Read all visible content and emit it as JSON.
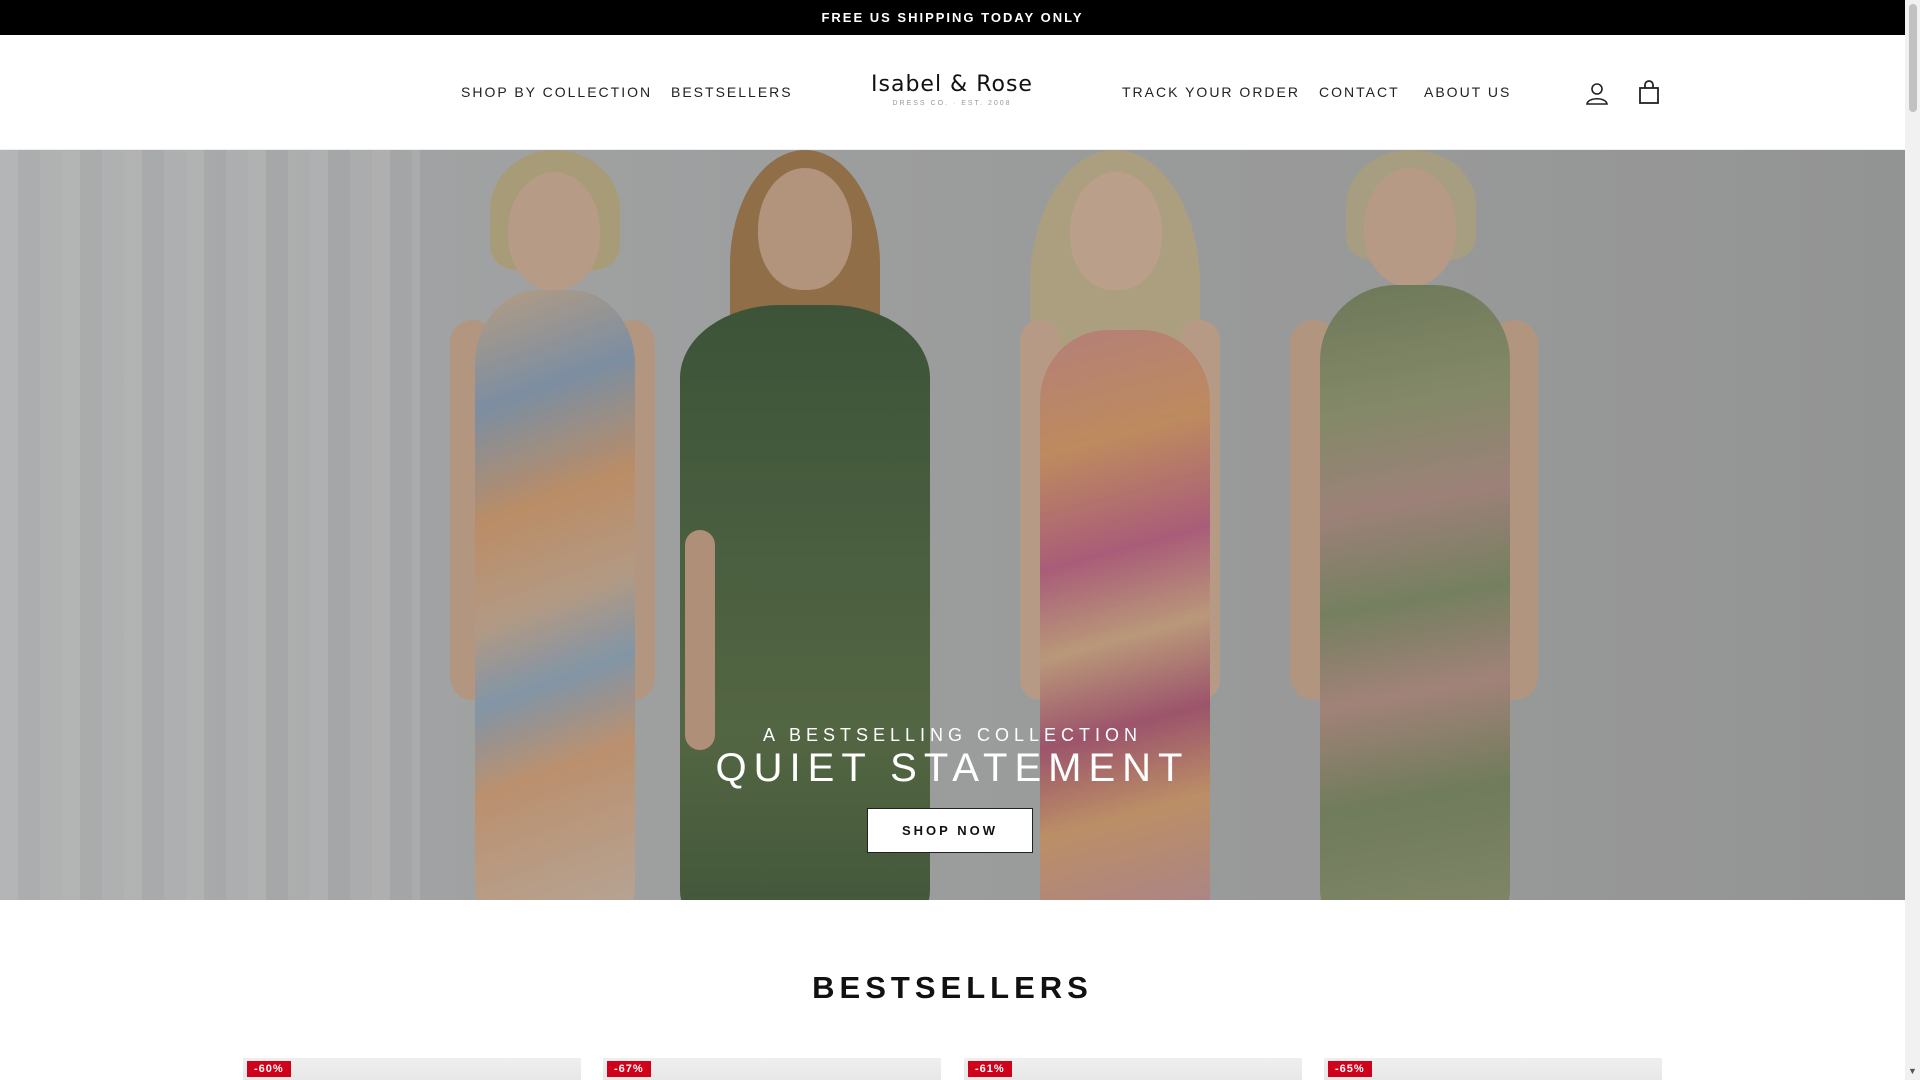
{
  "announcement": {
    "text": "FREE US SHIPPING TODAY ONLY"
  },
  "header": {
    "nav_left": [
      "SHOP BY COLLECTION",
      "BESTSELLERS"
    ],
    "nav_right": [
      "TRACK YOUR ORDER",
      "CONTACT",
      "ABOUT US"
    ],
    "logo": {
      "name": "Isabel & Rose",
      "subtitle": "DRESS CO. · EST. 2008"
    },
    "icons": {
      "account": "account-icon",
      "cart": "cart-icon"
    }
  },
  "hero": {
    "eyebrow": "A BESTSELLING COLLECTION",
    "title": "QUIET STATEMENT",
    "button_label": "SHOP NOW"
  },
  "bestsellers": {
    "title": "BESTSELLERS",
    "products": [
      {
        "discount": "-60%"
      },
      {
        "discount": "-67%"
      },
      {
        "discount": "-61%"
      },
      {
        "discount": "-65%"
      }
    ]
  },
  "colors": {
    "announcement_bg": "#000000",
    "badge_red": "#d0021b"
  }
}
